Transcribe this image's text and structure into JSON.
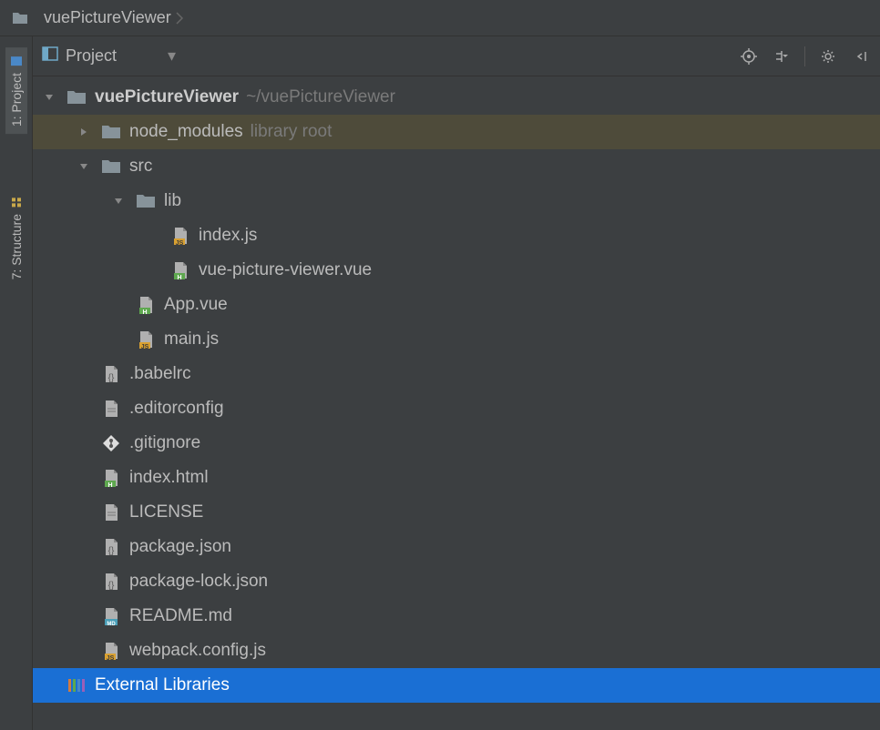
{
  "breadcrumb": {
    "project": "vuePictureViewer"
  },
  "sidebar": {
    "tabs": [
      {
        "label": "1: Project",
        "active": true
      },
      {
        "label": "7: Structure",
        "active": false
      }
    ]
  },
  "panel": {
    "title": "Project"
  },
  "tree": [
    {
      "depth": 0,
      "arrow": "down",
      "icon": "folder",
      "label": "vuePictureViewer",
      "labelBold": true,
      "suffix": "~/vuePictureViewer",
      "highlighted": false
    },
    {
      "depth": 1,
      "arrow": "right",
      "icon": "folder",
      "label": "node_modules",
      "suffix": "library root",
      "highlighted": true
    },
    {
      "depth": 1,
      "arrow": "down",
      "icon": "folder",
      "label": "src"
    },
    {
      "depth": 2,
      "arrow": "down",
      "icon": "folder",
      "label": "lib"
    },
    {
      "depth": 3,
      "arrow": "",
      "icon": "js",
      "label": "index.js"
    },
    {
      "depth": 3,
      "arrow": "",
      "icon": "vue",
      "label": "vue-picture-viewer.vue"
    },
    {
      "depth": 2,
      "arrow": "",
      "icon": "vue",
      "label": "App.vue"
    },
    {
      "depth": 2,
      "arrow": "",
      "icon": "js",
      "label": "main.js"
    },
    {
      "depth": 1,
      "arrow": "",
      "icon": "json",
      "label": ".babelrc"
    },
    {
      "depth": 1,
      "arrow": "",
      "icon": "file",
      "label": ".editorconfig"
    },
    {
      "depth": 1,
      "arrow": "",
      "icon": "git",
      "label": ".gitignore"
    },
    {
      "depth": 1,
      "arrow": "",
      "icon": "html",
      "label": "index.html"
    },
    {
      "depth": 1,
      "arrow": "",
      "icon": "file",
      "label": "LICENSE"
    },
    {
      "depth": 1,
      "arrow": "",
      "icon": "json",
      "label": "package.json"
    },
    {
      "depth": 1,
      "arrow": "",
      "icon": "json",
      "label": "package-lock.json"
    },
    {
      "depth": 1,
      "arrow": "",
      "icon": "md",
      "label": "README.md"
    },
    {
      "depth": 1,
      "arrow": "",
      "icon": "js",
      "label": "webpack.config.js"
    },
    {
      "depth": 0,
      "arrow": "",
      "icon": "lib",
      "label": "External Libraries",
      "selected": true
    }
  ]
}
